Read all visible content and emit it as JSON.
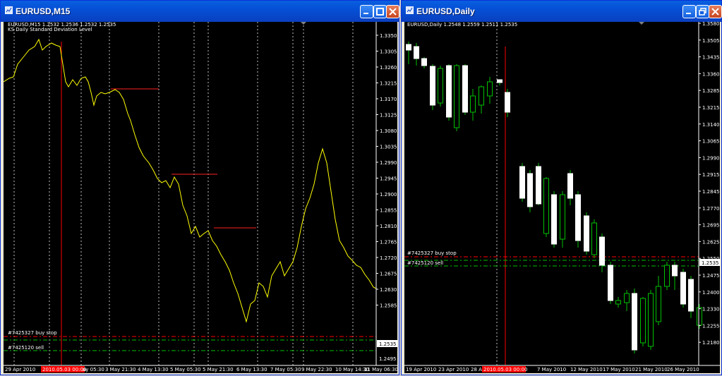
{
  "left_window": {
    "title": "EURUSD,M15",
    "info": "EURUSD,M15  1.2532 1.2536 1.2532 1.2535",
    "indicator": "KS Daily Standard Deviation Level",
    "price_axis": [
      "1.3350",
      "1.3305",
      "1.3260",
      "1.3215",
      "1.3170",
      "1.3125",
      "1.3080",
      "1.3035",
      "1.2990",
      "1.2945",
      "1.2900",
      "1.2855",
      "1.2810",
      "1.2765",
      "1.2720",
      "1.2675",
      "1.2630",
      "1.2585"
    ],
    "price_axis_bottom": "1.2495",
    "current_price": "1.2535",
    "time_axis": [
      "29 Apr 2010",
      "2010.05.03 00:00",
      "ay 05:30",
      "3 May 21:30",
      "4 May 13:30",
      "5 May 05:30",
      "5 May 21:30",
      "6 May 13:30",
      "7 May 05:30",
      "9 May 22:30",
      "10 May 14:30",
      "11 May 06:30"
    ],
    "orders": [
      {
        "label": "#7425327 buy stop"
      },
      {
        "label": "#7425120 sell"
      }
    ]
  },
  "right_window": {
    "title": "EURUSD,Daily",
    "info": "EURUSD,Daily  1.2548 1.2559 1.2511 1.2535",
    "price_axis": [
      "1.3580",
      "1.3505",
      "1.3435",
      "1.3360",
      "1.3285",
      "1.3215",
      "1.3140",
      "1.3065",
      "1.2990",
      "1.2915",
      "1.2845",
      "1.2770",
      "1.2695",
      "1.2625",
      "1.2550",
      "1.2475",
      "1.2400",
      "1.2330",
      "1.2255",
      "1.2180"
    ],
    "current_price": "1.2535",
    "time_axis": [
      "19 Apr 2010",
      "23 Apr 2010",
      "28 Ap",
      "2010.05.03 00:00",
      "7 May 2010",
      "12 May 2010",
      "17 May 2010",
      "21 May 2010",
      "26 May 2010"
    ],
    "orders": [
      {
        "label": "#7425327 buy stop"
      },
      {
        "label": "#7425120 sell"
      }
    ]
  },
  "colors": {
    "line": "#ffff00",
    "bull": "#ffffff",
    "bear": "#ffffff",
    "wick": "#00c000",
    "grid": "#c0c0c0",
    "marker": "#ff0000"
  }
}
